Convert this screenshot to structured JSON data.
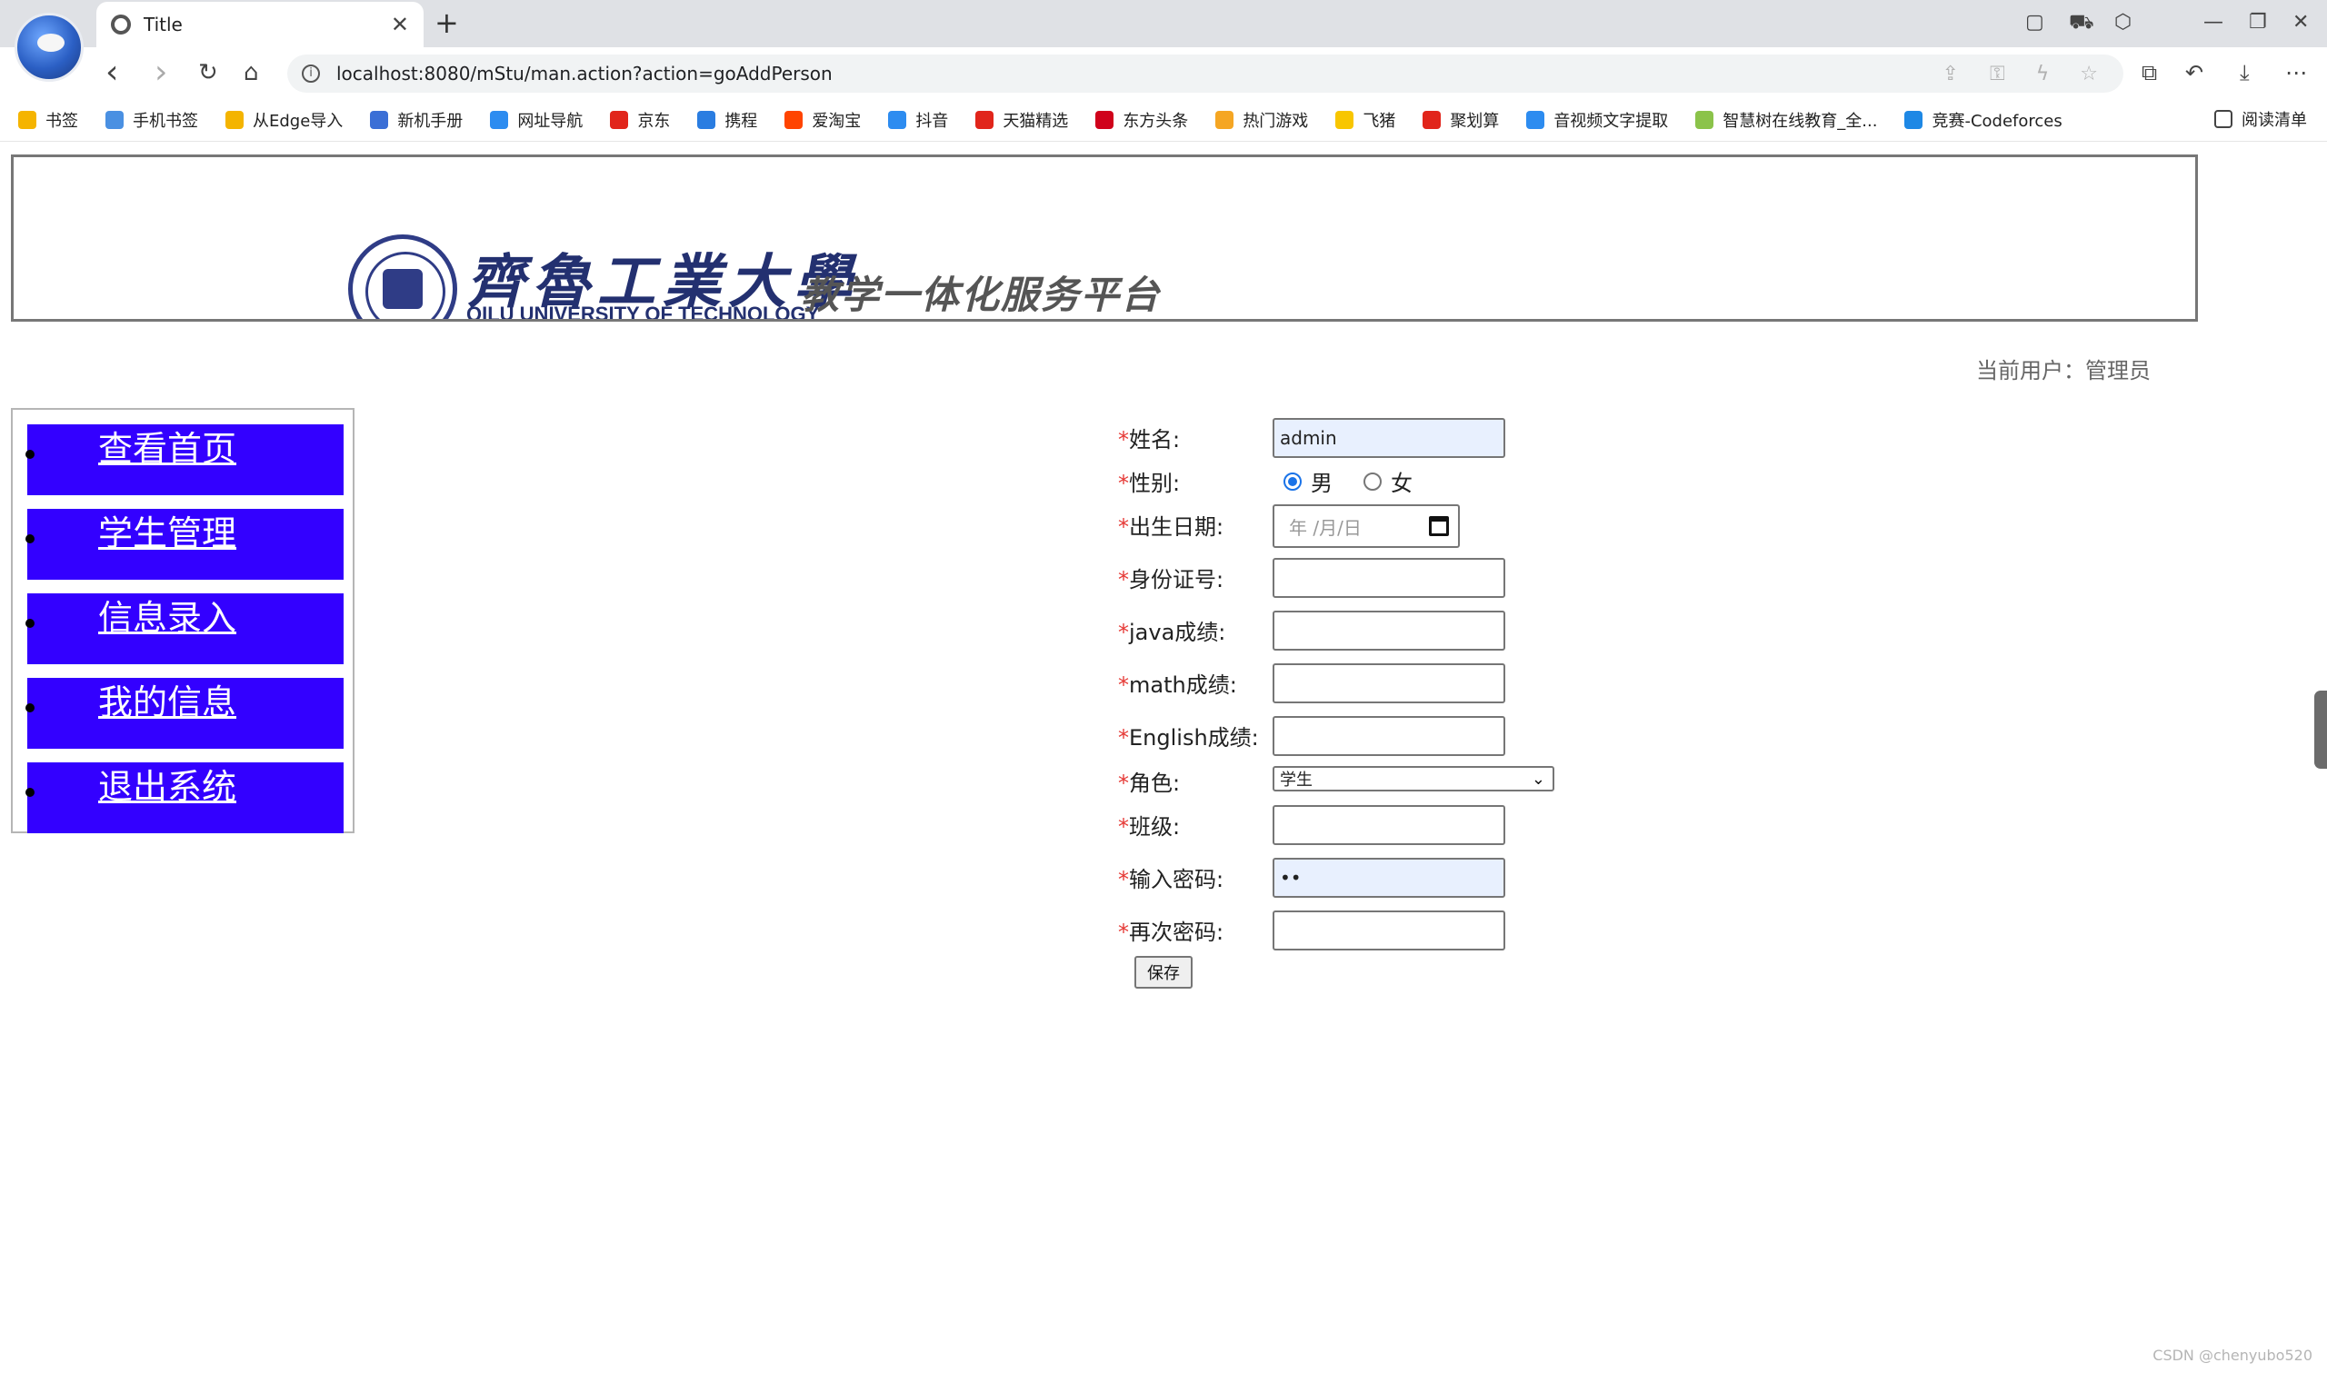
{
  "browser": {
    "tab_title": "Title",
    "tab_close": "✕",
    "new_tab": "+",
    "url": "localhost:8080/mStu/man.action?action=goAddPerson",
    "info_icon": "i",
    "nav": {
      "back": "‹",
      "forward": "›",
      "reload": "↻",
      "home": "⌂"
    },
    "window": {
      "minimize": "—",
      "restore": "❐",
      "close": "✕"
    },
    "toolbar_icons": [
      "share-icon",
      "key-icon",
      "bolt-icon",
      "star-icon",
      "extensions-icon",
      "history-icon",
      "download-icon",
      "more-icon"
    ],
    "more": "⋯"
  },
  "bookmarks": [
    {
      "label": "书签",
      "color": "#f5b400"
    },
    {
      "label": "手机书签",
      "color": "#4a90e2"
    },
    {
      "label": "从Edge导入",
      "color": "#f4b400"
    },
    {
      "label": "新机手册",
      "color": "#3b6fd6"
    },
    {
      "label": "网址导航",
      "color": "#2d8cf0"
    },
    {
      "label": "京东",
      "color": "#e1251b"
    },
    {
      "label": "携程",
      "color": "#2a7de1"
    },
    {
      "label": "爱淘宝",
      "color": "#ff4400"
    },
    {
      "label": "抖音",
      "color": "#2d8cf0"
    },
    {
      "label": "天猫精选",
      "color": "#e1251b"
    },
    {
      "label": "东方头条",
      "color": "#d0021b"
    },
    {
      "label": "热门游戏",
      "color": "#f5a623"
    },
    {
      "label": "飞猪",
      "color": "#f8c600"
    },
    {
      "label": "聚划算",
      "color": "#e1251b"
    },
    {
      "label": "音视频文字提取",
      "color": "#2d8cf0"
    },
    {
      "label": "智慧树在线教育_全...",
      "color": "#8bc34a"
    },
    {
      "label": "竞赛-Codeforces",
      "color": "#1e88e5"
    }
  ],
  "reading_list": "阅读清单",
  "banner": {
    "school_cn": "齊魯工業大學",
    "school_en": "QILU UNIVERSITY OF TECHNOLOGY",
    "platform": "教学一体化服务平台"
  },
  "current_user": "当前用户：管理员",
  "sidebar": [
    {
      "label": "查看首页"
    },
    {
      "label": "学生管理"
    },
    {
      "label": "信息录入"
    },
    {
      "label": "我的信息"
    },
    {
      "label": "退出系统"
    }
  ],
  "form": {
    "required_mark": "*",
    "name_label": "姓名:",
    "name_value": "admin",
    "gender_label": "性别:",
    "gender_male": "男",
    "gender_female": "女",
    "gender_selected": "男",
    "birth_label": "出生日期:",
    "birth_placeholder": "年 /月/日",
    "id_label": "身份证号:",
    "java_label": "java成绩:",
    "math_label": "math成绩:",
    "english_label": "English成绩:",
    "role_label": "角色:",
    "role_value": "学生",
    "class_label": "班级:",
    "password_label": "输入密码:",
    "password_value": "••",
    "confirm_label": "再次密码:",
    "save_label": "保存"
  },
  "watermark": "CSDN @chenyubo520"
}
